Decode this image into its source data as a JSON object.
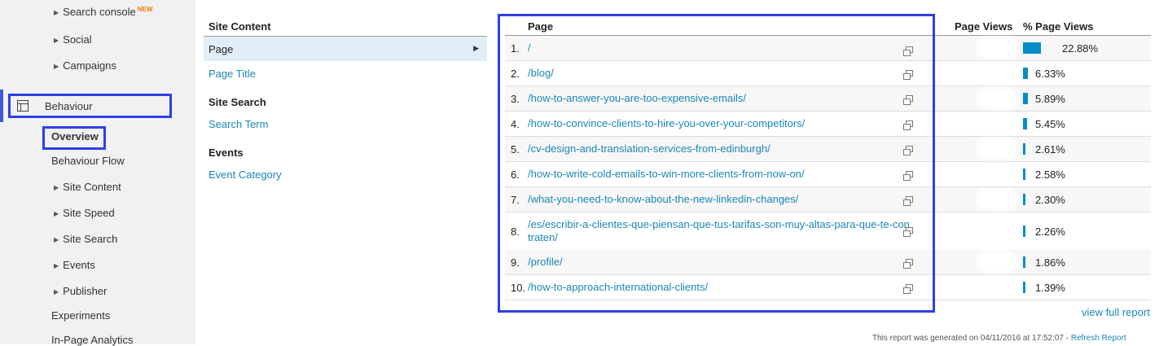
{
  "sidebar": {
    "search_console": "Search console",
    "new_badge": "NEW",
    "social": "Social",
    "campaigns": "Campaigns",
    "behaviour": "Behaviour",
    "overview": "Overview",
    "behaviour_flow": "Behaviour Flow",
    "site_content": "Site Content",
    "site_speed": "Site Speed",
    "site_search": "Site Search",
    "events": "Events",
    "publisher": "Publisher",
    "experiments": "Experiments",
    "in_page_analytics": "In-Page Analytics"
  },
  "dimension_panel": {
    "site_content_header": "Site Content",
    "page": "Page",
    "page_title": "Page Title",
    "site_search_header": "Site Search",
    "search_term": "Search Term",
    "events_header": "Events",
    "event_category": "Event Category"
  },
  "table": {
    "col_page": "Page",
    "col_page_views": "Page Views",
    "col_pct_page_views": "% Page Views",
    "rows": [
      {
        "num": "1.",
        "page": "/",
        "pct": "22.88%",
        "share": 0.2288
      },
      {
        "num": "2.",
        "page": "/blog/",
        "pct": "6.33%",
        "share": 0.0633
      },
      {
        "num": "3.",
        "page": "/how-to-answer-you-are-too-expensive-emails/",
        "pct": "5.89%",
        "share": 0.0589
      },
      {
        "num": "4.",
        "page": "/how-to-convince-clients-to-hire-you-over-your-competitors/",
        "pct": "5.45%",
        "share": 0.0545
      },
      {
        "num": "5.",
        "page": "/cv-design-and-translation-services-from-edinburgh/",
        "pct": "2.61%",
        "share": 0.0261
      },
      {
        "num": "6.",
        "page": "/how-to-write-cold-emails-to-win-more-clients-from-now-on/",
        "pct": "2.58%",
        "share": 0.0258
      },
      {
        "num": "7.",
        "page": "/what-you-need-to-know-about-the-new-linkedin-changes/",
        "pct": "2.30%",
        "share": 0.023
      },
      {
        "num": "8.",
        "page": "/es/escribir-a-clientes-que-piensan-que-tus-tarifas-son-muy-altas-para-que-te-contraten/",
        "page_line1": "/es/escribir-a-clientes-que-piensan-que-tus-tarifas-son-muy-altas-para-que-te-con",
        "page_line2": "traten/",
        "pct": "2.26%",
        "share": 0.0226
      },
      {
        "num": "9.",
        "page": "/profile/",
        "pct": "1.86%",
        "share": 0.0186
      },
      {
        "num": "10.",
        "page": "/how-to-approach-international-clients/",
        "pct": "1.39%",
        "share": 0.0139
      }
    ]
  },
  "view_full_report": "view full report",
  "footer": {
    "generated_text": "This report was generated on 04/11/2016 at 17:52:07 - ",
    "refresh_link": "Refresh Report"
  },
  "colors": {
    "bar": "#058dc7",
    "link": "#1a87b8",
    "highlight_box": "#2f3fe6",
    "new_badge": "#f57c00"
  }
}
